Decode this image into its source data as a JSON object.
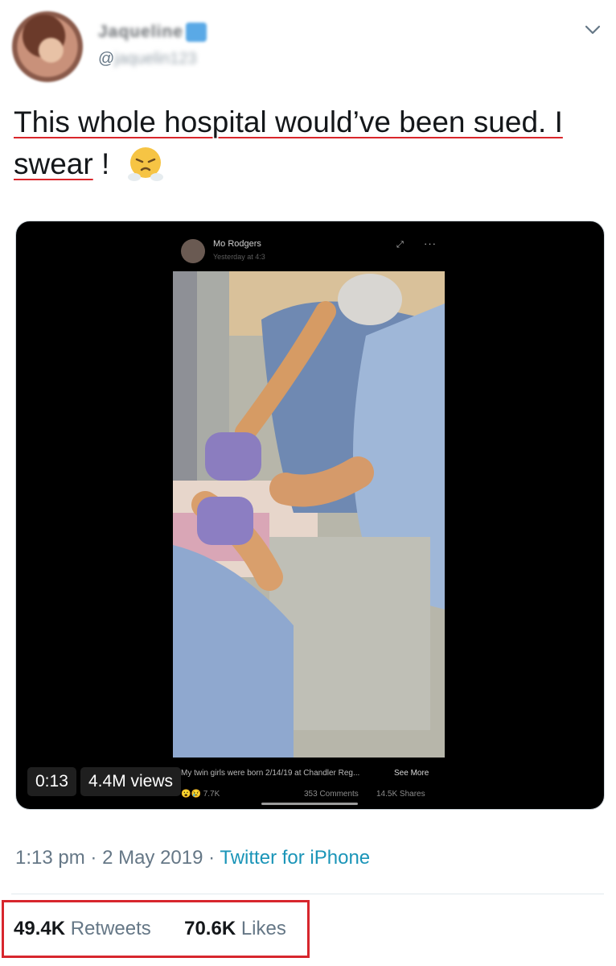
{
  "author": {
    "display_name": "Jaqueline",
    "handle": "@",
    "handle_hidden": "jaquelin123"
  },
  "tweet": {
    "text_line1": "This whole hospital would’ve been sued. I",
    "text_line2": "swear",
    "text_punct": " !",
    "emoji": "face-with-steam-from-nose"
  },
  "media": {
    "fb_poster": "Mo Rodgers",
    "fb_time": "Yesterday at 4:3",
    "caption": "My twin girls were born 2/14/19 at Chandler Reg...",
    "see_more": "See More",
    "reactions": "7.7K",
    "comments": "353 Comments",
    "shares": "14.5K Shares",
    "duration": "0:13",
    "views": "4.4M views"
  },
  "meta": {
    "time": "1:13 pm",
    "date": "2 May 2019",
    "source": "Twitter for iPhone"
  },
  "stats": {
    "retweets_count": "49.4K",
    "retweets_label": "Retweets",
    "likes_count": "70.6K",
    "likes_label": "Likes"
  },
  "colors": {
    "link": "#1b95b8",
    "muted": "#657786",
    "highlight_box": "#d7262d"
  }
}
